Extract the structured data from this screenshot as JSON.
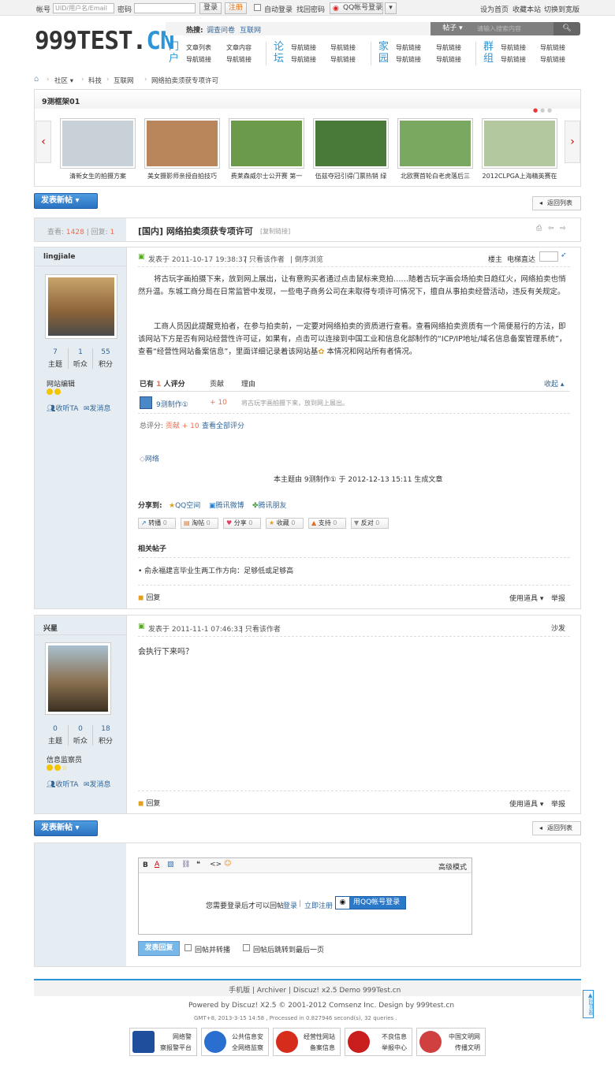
{
  "topbar": {
    "account_label": "帐号",
    "account_placeholder": "UID/用户名/Email",
    "password_label": "密码",
    "login": "登录",
    "register": "注册",
    "auto_login": "自动登录",
    "recover": "找回密码",
    "qq_login": "QQ帐号登录",
    "set_home": "设为首页",
    "bookmark": "收藏本站",
    "wide": "切换到宽版"
  },
  "logo": {
    "main": "999TEST.",
    "suffix": "CN"
  },
  "nav": {
    "hot_label": "热搜:",
    "hot1": "调查问卷",
    "hot2": "互联网",
    "search_type": "帖子",
    "search_placeholder": "请输入搜索内容",
    "c1a": "门",
    "c1b": "户",
    "c2a": "论",
    "c2b": "坛",
    "c3a": "家",
    "c3b": "园",
    "c4a": "群",
    "c4b": "组",
    "g1": [
      "文章列表",
      "文章内容",
      "导航链接",
      "导航链接"
    ],
    "g2": [
      "导航链接",
      "导航链接",
      "导航链接",
      "导航链接"
    ],
    "g3": [
      "导航链接",
      "导航链接",
      "导航链接",
      "导航链接"
    ],
    "g4": [
      "导航链接",
      "导航链接",
      "导航链接",
      "导航链接"
    ]
  },
  "breadcrumb": {
    "c1": "社区",
    "c2": "科技",
    "c3": "互联网",
    "c4": "网络拍卖须获专项许可"
  },
  "slider": {
    "title": "9测框架01",
    "captions": [
      "清新女生的拍摄方案",
      "美女摄影师亲授自拍技巧",
      "费莱森威尔士公开赛 第一",
      "伍兹夺冠引得门票热销 绿",
      "北欧赛首轮白老虎落后三",
      "2012CLPGA上海精英赛在"
    ],
    "colors": [
      "#c8d0d8",
      "#b8865a",
      "#6a9a4a",
      "#4a7a3a",
      "#7aa860",
      "#b4c8a0"
    ]
  },
  "toolbar": {
    "new_post": "发表新帖",
    "back": "返回列表"
  },
  "thread": {
    "views_label": "查看:",
    "views": "1428",
    "replies_label": "回复:",
    "replies": "1",
    "type": "[国内]",
    "title": "网络拍卖须获专项许可",
    "copy": "[复制链接]"
  },
  "post1": {
    "author": "lingjiale",
    "stats": [
      {
        "n": "7",
        "l": "主题"
      },
      {
        "n": "1",
        "l": "听众"
      },
      {
        "n": "55",
        "l": "积分"
      }
    ],
    "group": "网站编辑",
    "follow": "收听TA",
    "message": "发消息",
    "time": "发表于 2011-10-17 19:38:37",
    "only_author": "只看该作者",
    "reverse": "倒序浏览",
    "floor": "楼主",
    "jump": "电梯直达",
    "p1": "将古玩字画拍摄下来，放到网上展出，让有意购买者通过点击鼠标来竞拍……随着古玩字画会场拍卖日趋红火，网络拍卖也悄然升温。东城工商分局在日常监管中发现，一些电子商务公司在未取得专项许可情况下，擅自从事拍卖经营活动，违反有关规定。",
    "p2": "工商人员因此提醒竞拍者，在参与拍卖前，一定要对网络拍卖的资质进行查看。查看网络拍卖资质有一个简便易行的方法，即该网站下方是否有网站经营性许可证，如果有，点击可以连接到中国工业和信息化部制作的“ICP/IP地址/域名信息备案管理系统”，查看“经营性网站备案信息”，里面详细记录着该网站基",
    "p2b": "本情况和网站所有者情况。",
    "rate_head": "已有",
    "rate_n": "1",
    "rate_tail": "人评分",
    "rate_col2": "贡献",
    "rate_col3": "理由",
    "rate_collapse": "收起",
    "rater": "9测制作①",
    "rate_val": "+ 10",
    "rate_reason": "将古玩字画拍摄下来，放到网上展出。",
    "total_label": "总评分:",
    "total_val": "贡献 + 10",
    "view_all": "查看全部评分",
    "tag": "网络",
    "generated": "本主题由 9测制作① 于 2012-12-13 15:11 生成文章",
    "share_label": "分享到:",
    "share": [
      "QQ空间",
      "腾讯微博",
      "腾讯朋友"
    ],
    "actions": [
      "转播",
      "淘帖",
      "分享",
      "收藏",
      "支持",
      "反对"
    ],
    "action_counts": [
      "0",
      "0",
      "0",
      "0",
      "0",
      "0"
    ],
    "related_title": "相关帖子",
    "related": "俞永福建言毕业生两工作方向：足够低或足够高",
    "reply": "回复",
    "tools": "使用道具",
    "report": "举报"
  },
  "post2": {
    "author": "兴星",
    "stats": [
      {
        "n": "0",
        "l": "主题"
      },
      {
        "n": "0",
        "l": "听众"
      },
      {
        "n": "18",
        "l": "积分"
      }
    ],
    "group": "信息监察员",
    "follow": "收听TA",
    "message": "发消息",
    "time": "发表于 2011-11-1 07:46:33",
    "only_author": "只看该作者",
    "floor": "沙发",
    "body": "会执行下来吗？",
    "reply": "回复",
    "tools": "使用道具",
    "report": "举报"
  },
  "editor": {
    "advanced": "高级模式",
    "login_tip": "您需要登录后才可以回帖",
    "login": "登录",
    "register": "立即注册",
    "qq": "用QQ帐号登录",
    "submit": "发表回复",
    "opt1": "回帖并转播",
    "opt2": "回帖后跳转到最后一页"
  },
  "footer": {
    "links": "手机版 | Archiver | Discuz! x2.5 Demo 999Test.cn",
    "powered": "Powered by Discuz! X2.5 © 2001-2012 Comsenz Inc. Design by 999test.cn",
    "gmt": "GMT+8, 2013-3-15 14:58 , Processed in 0.827946 second(s), 32 queries .",
    "back_top": "回顶部",
    "badges": [
      {
        "a": "网络警",
        "b": "察报警平台",
        "c": "#1e4e9c"
      },
      {
        "a": "公共信息安",
        "b": "全网络监察",
        "c": "#2a6fd0"
      },
      {
        "a": "经营性网站",
        "b": "备案信息",
        "c": "#d62c1c"
      },
      {
        "a": "不良信息",
        "b": "举报中心",
        "c": "#c81e1e"
      },
      {
        "a": "中国文明网",
        "b": "传播文明",
        "c": "#d04040"
      }
    ]
  }
}
